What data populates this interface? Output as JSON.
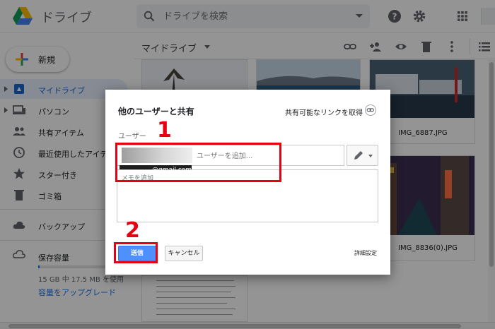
{
  "header": {
    "app_title": "ドライブ",
    "search_placeholder": "ドライブを検索",
    "icons": [
      "help-icon",
      "settings-icon",
      "apps-icon"
    ]
  },
  "sidebar": {
    "new_label": "新規",
    "items": [
      {
        "label": "マイドライブ",
        "icon": "drive-icon",
        "active": true
      },
      {
        "label": "パソコン",
        "icon": "computer-icon"
      },
      {
        "label": "共有アイテム",
        "icon": "people-icon"
      },
      {
        "label": "最近使用したアイテム",
        "icon": "clock-icon"
      },
      {
        "label": "スター付き",
        "icon": "star-icon"
      },
      {
        "label": "ゴミ箱",
        "icon": "trash-icon"
      },
      {
        "label": "バックアップ",
        "icon": "cloud-icon"
      }
    ],
    "storage": {
      "label": "保存容量",
      "usage": "15 GB 中 17.5 MB を使用",
      "upgrade": "容量をアップグレード",
      "used_fraction": 0.002
    }
  },
  "main": {
    "breadcrumb": "マイドライブ",
    "toolbar_icons": [
      "link-icon",
      "add-person-icon",
      "preview-icon",
      "delete-icon",
      "more-icon",
      "list-view-icon"
    ],
    "files": [
      {
        "name": "IMG_6887.JPG"
      },
      {
        "name": "IMG_8836(0).JPG"
      }
    ]
  },
  "dialog": {
    "title": "他のユーザーと共有",
    "shareable_link": "共有可能なリンクを取得",
    "users_label": "ユーザー",
    "email_chip": "@gmail.com",
    "add_user_placeholder": "ユーザーを追加...",
    "note_placeholder": "メモを追加",
    "send_label": "送信",
    "cancel_label": "キャンセル",
    "advanced_label": "詳細設定"
  },
  "annotations": {
    "step1": "1",
    "step2": "2",
    "color": "#e60012"
  }
}
